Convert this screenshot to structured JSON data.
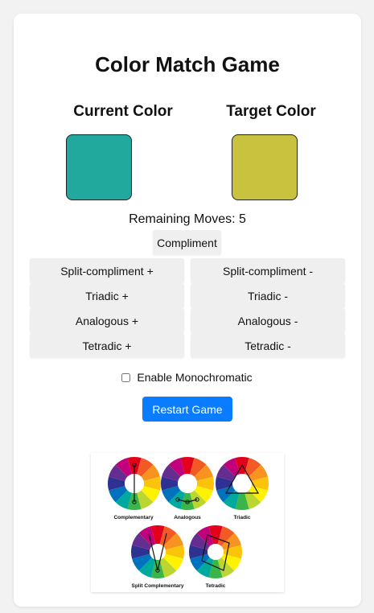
{
  "title": "Color Match Game",
  "current": {
    "label": "Current Color",
    "color": "#21a99e"
  },
  "target": {
    "label": "Target Color",
    "color": "#c9c23f"
  },
  "moves_text": "Remaining Moves: 5",
  "buttons": {
    "compliment": "Compliment",
    "split_plus": "Split-compliment +",
    "split_minus": "Split-compliment -",
    "triadic_plus": "Triadic +",
    "triadic_minus": "Triadic -",
    "analogous_plus": "Analogous +",
    "analogous_minus": "Analogous -",
    "tetradic_plus": "Tetradic +",
    "tetradic_minus": "Tetradic -"
  },
  "monochromatic_label": "Enable Monochromatic",
  "monochromatic_checked": false,
  "restart_label": "Restart Game",
  "wheel_labels": {
    "complementary": "Complementary",
    "analogous": "Analogous",
    "triadic": "Triadic",
    "split": "Split Complementary",
    "tetradic": "Tetradic"
  },
  "accent_color": "#0a7cff"
}
